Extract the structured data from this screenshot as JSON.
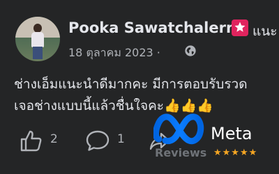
{
  "post": {
    "author_name": "Pooka Sawatchalerm",
    "badge_text": "แนะ",
    "date": "18 ตุลาคม 2023 ·",
    "text_line1": "ช่างเอ็มแนะนำดีมากคะ มีการตอบรับรวด",
    "text_line2": "เจอช่างแบบนี้แล้วชื่นใจคะ👍👍👍",
    "like_count": "2",
    "comment_count": "1"
  },
  "icons": {
    "avatar": "profile-photo",
    "badge": "recommend-star-icon",
    "privacy": "globe-icon",
    "like": "thumbs-up-icon",
    "comment": "comment-bubble-icon",
    "share": "share-icon"
  },
  "overlay": {
    "brand": "Meta",
    "subtitle": "Reviews",
    "stars": "★★★★★",
    "rating": 5
  },
  "colors": {
    "background": "#242526",
    "text": "#e4e6eb",
    "secondary_text": "#b0b3b8",
    "badge": "#e0245e",
    "meta_blue": "#0866ff",
    "stars": "#f5a623"
  }
}
